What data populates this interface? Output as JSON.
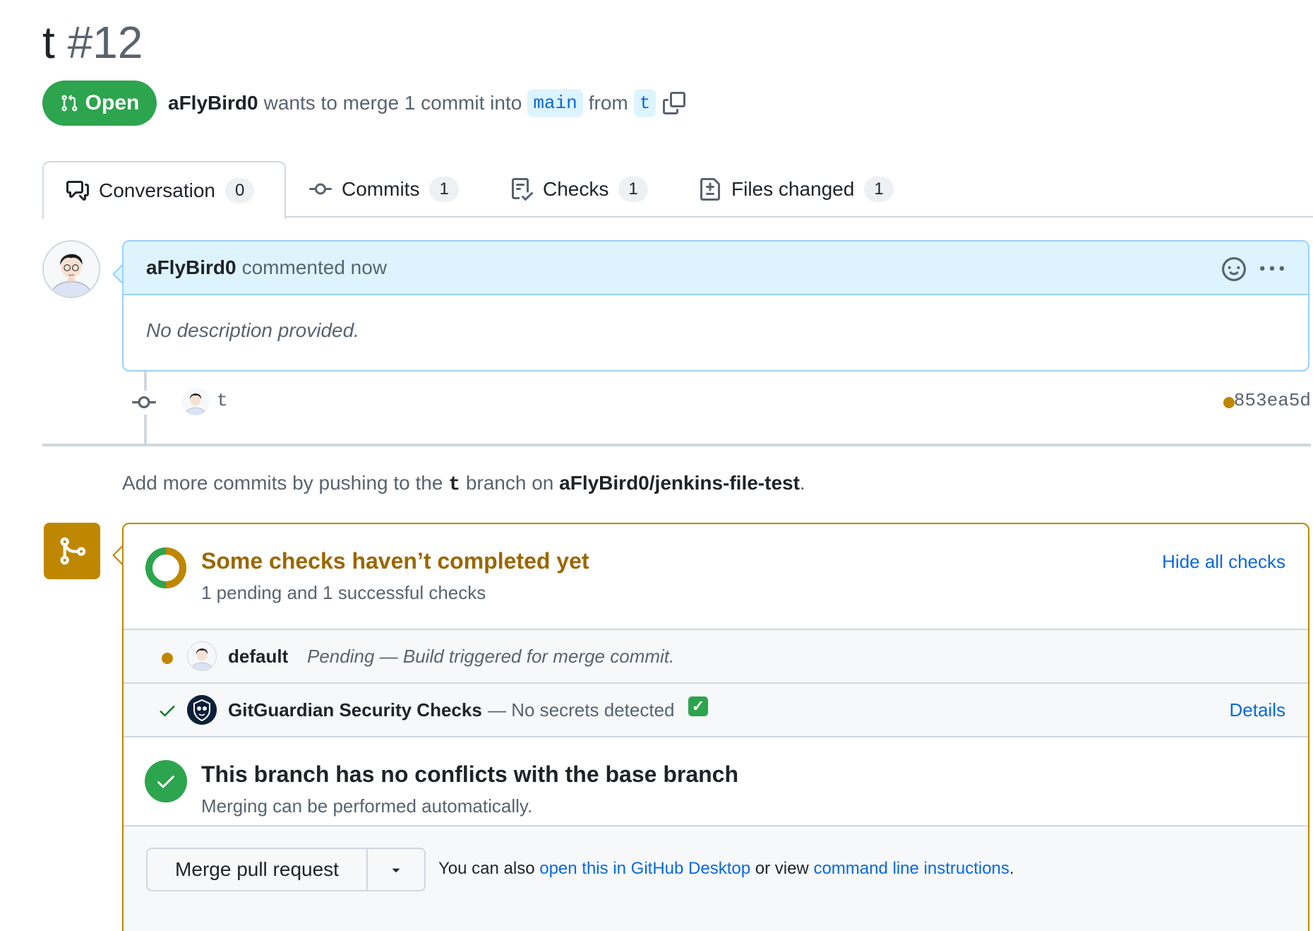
{
  "pr": {
    "title": "t",
    "number": "#12",
    "status": "Open",
    "author": "aFlyBird0",
    "merge_text": "wants to merge 1 commit into",
    "base_branch": "main",
    "from_text": "from",
    "head_branch": "t"
  },
  "tabs": [
    {
      "label": "Conversation",
      "count": "0",
      "icon": "comment-discussion-icon"
    },
    {
      "label": "Commits",
      "count": "1",
      "icon": "git-commit-icon"
    },
    {
      "label": "Checks",
      "count": "1",
      "icon": "checklist-icon"
    },
    {
      "label": "Files changed",
      "count": "1",
      "icon": "file-diff-icon"
    }
  ],
  "comment": {
    "author": "aFlyBird0",
    "action": "commented now",
    "body": "No description provided."
  },
  "commit": {
    "message": "t",
    "sha": "853ea5d",
    "status_color": "#bf8700"
  },
  "push_info": {
    "prefix": "Add more commits by pushing to the",
    "branch": "t",
    "middle": "branch on",
    "repo": "aFlyBird0/jenkins-file-test",
    "suffix": "."
  },
  "checks": {
    "title": "Some checks haven’t completed yet",
    "subtitle": "1 pending and 1 successful checks",
    "toggle_label": "Hide all checks",
    "items": [
      {
        "name": "default",
        "description": "Pending — Build triggered for merge commit.",
        "state": "pending"
      },
      {
        "name": "GitGuardian Security Checks",
        "description": "— No secrets detected",
        "emoji": "✅",
        "state": "success",
        "details_label": "Details"
      }
    ]
  },
  "conflicts": {
    "title": "This branch has no conflicts with the base branch",
    "subtitle": "Merging can be performed automatically."
  },
  "merge": {
    "button_label": "Merge pull request",
    "also_text": "You can also",
    "desktop_link": "open this in GitHub Desktop",
    "or_view": "or view",
    "cli_link": "command line instructions",
    "period": "."
  },
  "colors": {
    "open_green": "#2da44e",
    "pending_yellow": "#bf8700",
    "link_blue": "#0969da"
  }
}
